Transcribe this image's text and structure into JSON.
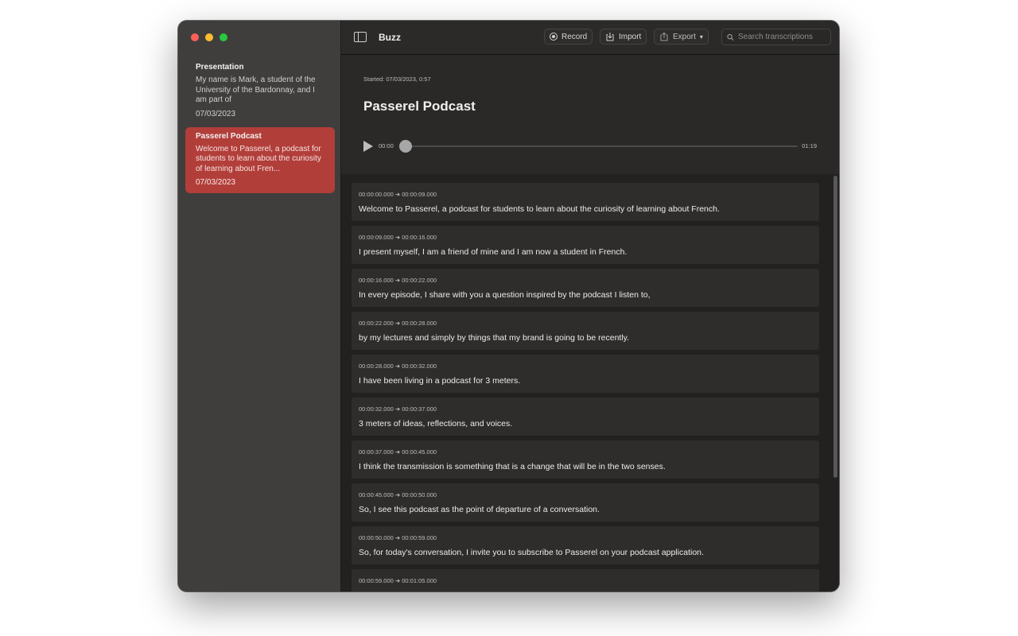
{
  "app": {
    "title": "Buzz"
  },
  "toolbar": {
    "record_label": "Record",
    "import_label": "Import",
    "export_label": "Export",
    "search_placeholder": "Search transcriptions"
  },
  "sidebar": {
    "items": [
      {
        "title": "Presentation",
        "preview": "My name is Mark, a student of the University of the Bardonnay, and I am part of",
        "date": "07/03/2023",
        "selected": false
      },
      {
        "title": "Passerel Podcast",
        "preview": "Welcome to Passerel, a podcast for students to learn about the curiosity of learning about Fren...",
        "date": "07/03/2023",
        "selected": true
      }
    ]
  },
  "detail": {
    "started": "Started: 07/03/2023, 0:57",
    "title": "Passerel Podcast",
    "player": {
      "current": "00:00",
      "total": "01:19",
      "progress": 0
    }
  },
  "segments": [
    {
      "start": "00:00:00.000",
      "end": "00:00:09.000",
      "text": "Welcome to Passerel, a podcast for students to learn about the curiosity of learning about French."
    },
    {
      "start": "00:00:09.000",
      "end": "00:00:16.000",
      "text": "I present myself, I am a friend of mine and I am now a student in French."
    },
    {
      "start": "00:00:16.000",
      "end": "00:00:22.000",
      "text": "In every episode, I share with you a question inspired by the podcast I listen to,"
    },
    {
      "start": "00:00:22.000",
      "end": "00:00:28.000",
      "text": "by my lectures and simply by things that my brand is going to be recently."
    },
    {
      "start": "00:00:28.000",
      "end": "00:00:32.000",
      "text": "I have been living in a podcast for 3 meters."
    },
    {
      "start": "00:00:32.000",
      "end": "00:00:37.000",
      "text": "3 meters of ideas, reflections, and voices."
    },
    {
      "start": "00:00:37.000",
      "end": "00:00:45.000",
      "text": "I think the transmission is something that is a change that will be in the two senses."
    },
    {
      "start": "00:00:45.000",
      "end": "00:00:50.000",
      "text": "So, I see this podcast as the point of departure of a conversation."
    },
    {
      "start": "00:00:50.000",
      "end": "00:00:59.000",
      "text": "So, for today's conversation, I invite you to subscribe to Passerel on your podcast application."
    },
    {
      "start": "00:00:59.000",
      "end": "00:01:05.000",
      "text": ""
    }
  ]
}
